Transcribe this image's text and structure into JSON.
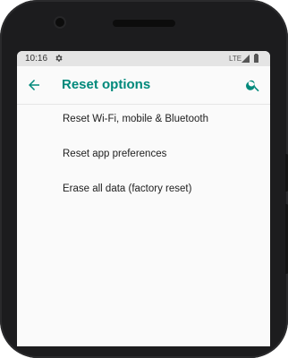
{
  "status_bar": {
    "time": "10:16",
    "network": "LTE",
    "icons": [
      "settings-gear-icon",
      "signal-icon",
      "battery-icon"
    ]
  },
  "toolbar": {
    "title": "Reset options",
    "back_icon": "arrow-back-icon",
    "search_icon": "search-icon"
  },
  "menu": {
    "items": [
      {
        "label": "Reset Wi-Fi, mobile & Bluetooth"
      },
      {
        "label": "Reset app preferences"
      },
      {
        "label": "Erase all data (factory reset)"
      }
    ]
  },
  "colors": {
    "accent": "#00897b",
    "background": "#fafafa",
    "status_bar": "#e4e4e4",
    "phone_frame": "#1c1c1e"
  }
}
